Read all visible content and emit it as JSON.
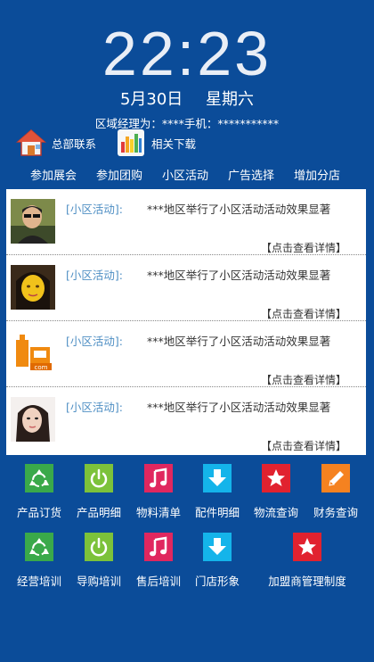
{
  "clock": {
    "time": "22:23",
    "date": "5月30日",
    "weekday": "星期六"
  },
  "manager_line": "区域经理为：****手机：***********",
  "quick_links": [
    {
      "label": "总部联系",
      "icon": "house-icon"
    },
    {
      "label": "相关下载",
      "icon": "bar-chart-icon"
    }
  ],
  "nav": [
    {
      "label": "参加展会"
    },
    {
      "label": "参加团购"
    },
    {
      "label": "小区活动"
    },
    {
      "label": "广告选择"
    },
    {
      "label": "增加分店"
    }
  ],
  "feed": [
    {
      "tag": "[小区活动]:",
      "text": "***地区举行了小区活动活动效果显著",
      "more": "【点击查看详情】",
      "avatar": "man-avatar"
    },
    {
      "tag": "[小区活动]:",
      "text": "***地区举行了小区活动活动效果显著",
      "more": "【点击查看详情】",
      "avatar": "woman-yellow-avatar"
    },
    {
      "tag": "[小区活动]:",
      "text": "***地区举行了小区活动活动效果显著",
      "more": "【点击查看详情】",
      "avatar": "logo-avatar",
      "logo_text": "com"
    },
    {
      "tag": "[小区活动]:",
      "text": "***地区举行了小区活动活动效果显著",
      "more": "【点击查看详情】",
      "avatar": "woman-avatar"
    }
  ],
  "grid": [
    {
      "label": "产品订货",
      "icon": "recycle-icon",
      "color": "#3aa94a"
    },
    {
      "label": "产品明细",
      "icon": "power-icon",
      "color": "#7cc23a"
    },
    {
      "label": "物料清单",
      "icon": "music-icon",
      "color": "#e0275f"
    },
    {
      "label": "配件明细",
      "icon": "download-icon",
      "color": "#14b4ea"
    },
    {
      "label": "物流查询",
      "icon": "star-icon",
      "color": "#e1222f"
    },
    {
      "label": "财务查询",
      "icon": "pencil-icon",
      "color": "#f58220"
    },
    {
      "label": "经营培训",
      "icon": "recycle-icon",
      "color": "#3aa94a"
    },
    {
      "label": "导购培训",
      "icon": "power-icon",
      "color": "#7cc23a"
    },
    {
      "label": "售后培训",
      "icon": "music-icon",
      "color": "#e0275f"
    },
    {
      "label": "门店形象",
      "icon": "download-icon",
      "color": "#14b4ea"
    },
    {
      "label": "加盟商管理制度",
      "icon": "star-icon",
      "color": "#e1222f"
    }
  ]
}
